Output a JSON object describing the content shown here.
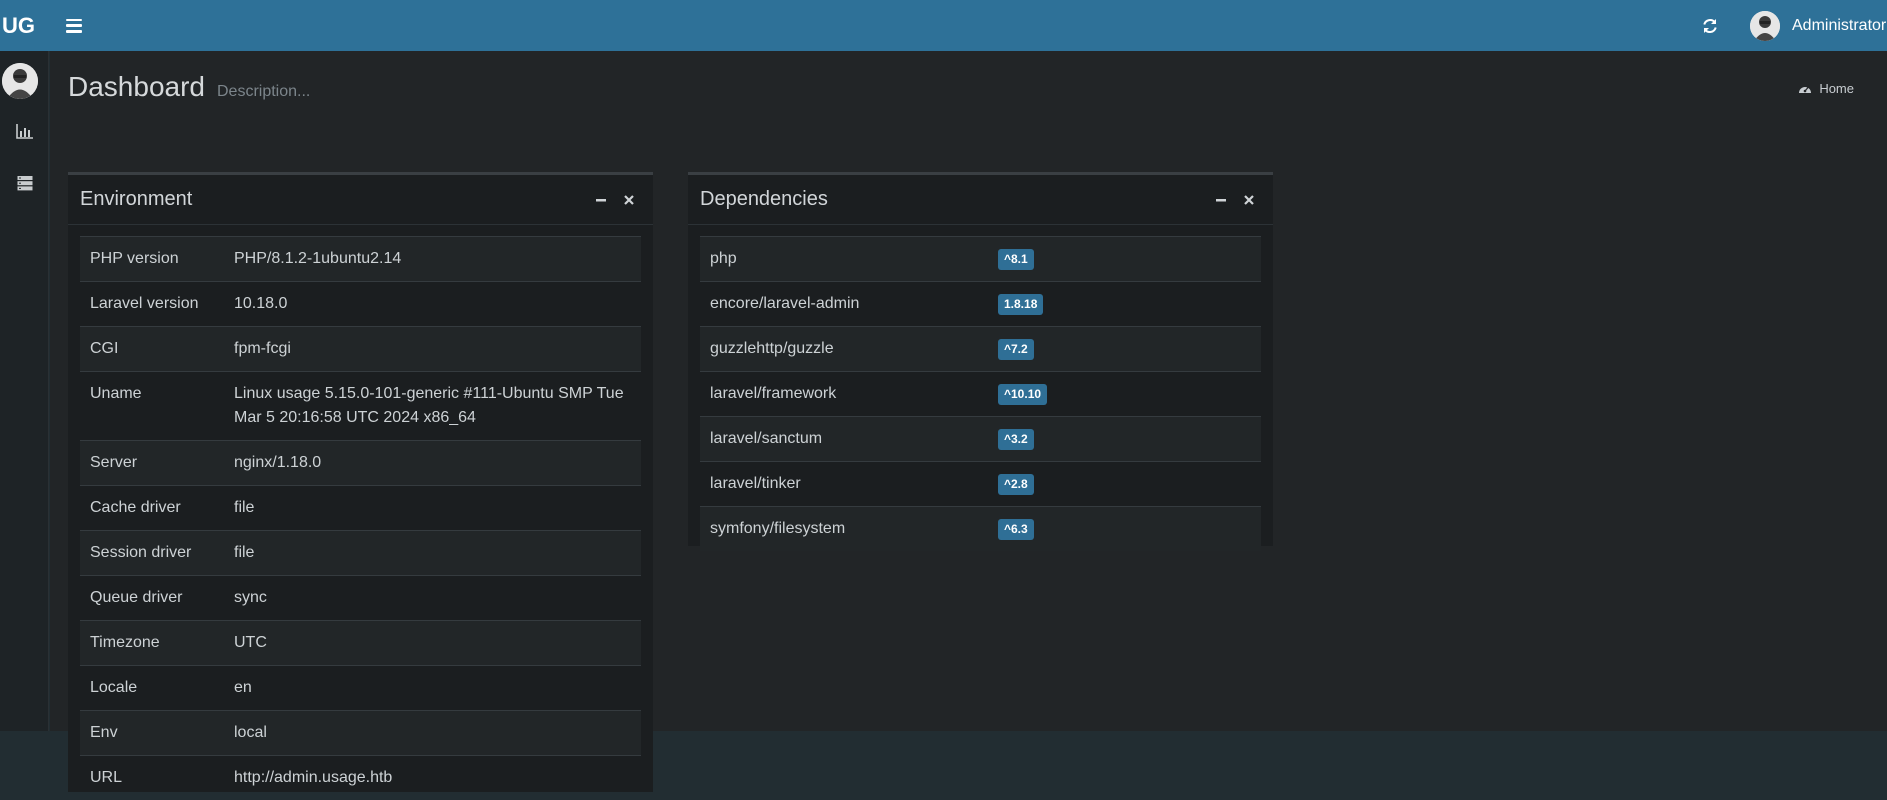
{
  "topbar": {
    "logo": "UG",
    "user_name": "Administrator",
    "icons": {
      "menu": "hamburger-icon",
      "refresh": "refresh-icon"
    }
  },
  "sidebar": {
    "icons": [
      "bar-chart-icon",
      "server-icon"
    ]
  },
  "page": {
    "title": "Dashboard",
    "description": "Description...",
    "breadcrumb": "Home"
  },
  "environment": {
    "title": "Environment",
    "rows": [
      {
        "key": "PHP version",
        "value": "PHP/8.1.2-1ubuntu2.14"
      },
      {
        "key": "Laravel version",
        "value": "10.18.0"
      },
      {
        "key": "CGI",
        "value": "fpm-fcgi"
      },
      {
        "key": "Uname",
        "value": "Linux usage 5.15.0-101-generic #111-Ubuntu SMP Tue Mar 5 20:16:58 UTC 2024 x86_64"
      },
      {
        "key": "Server",
        "value": "nginx/1.18.0"
      },
      {
        "key": "Cache driver",
        "value": "file"
      },
      {
        "key": "Session driver",
        "value": "file"
      },
      {
        "key": "Queue driver",
        "value": "sync"
      },
      {
        "key": "Timezone",
        "value": "UTC"
      },
      {
        "key": "Locale",
        "value": "en"
      },
      {
        "key": "Env",
        "value": "local"
      },
      {
        "key": "URL",
        "value": "http://admin.usage.htb"
      }
    ]
  },
  "dependencies": {
    "title": "Dependencies",
    "rows": [
      {
        "name": "php",
        "version": "^8.1"
      },
      {
        "name": "encore/laravel-admin",
        "version": "1.8.18"
      },
      {
        "name": "guzzlehttp/guzzle",
        "version": "^7.2"
      },
      {
        "name": "laravel/framework",
        "version": "^10.10"
      },
      {
        "name": "laravel/sanctum",
        "version": "^3.2"
      },
      {
        "name": "laravel/tinker",
        "version": "^2.8"
      },
      {
        "name": "symfony/filesystem",
        "version": "^6.3"
      }
    ]
  },
  "colors": {
    "header": "#2e7198",
    "label": "#2f6f96",
    "background": "#222527"
  }
}
